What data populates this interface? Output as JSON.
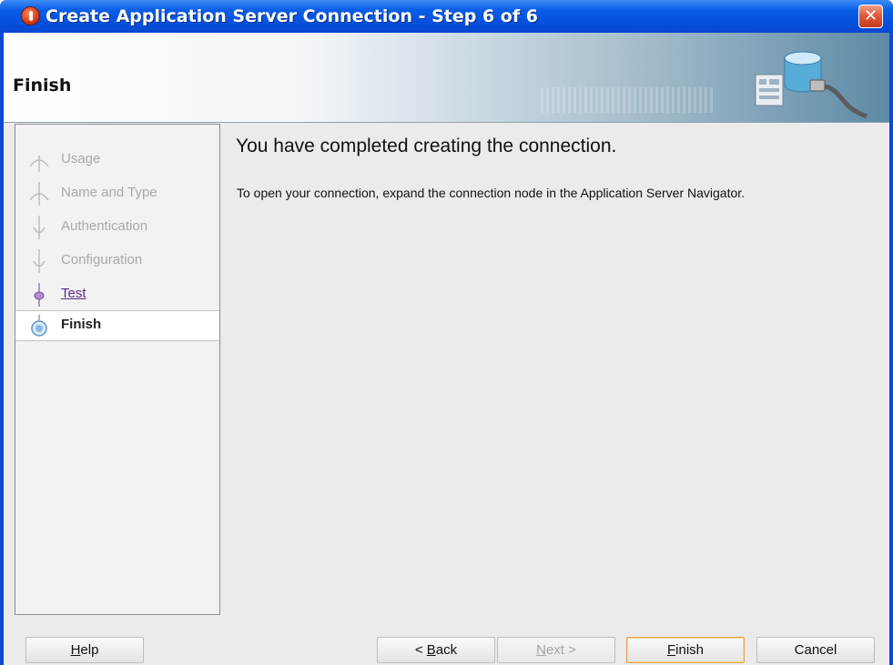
{
  "window": {
    "title": "Create Application Server Connection - Step 6 of 6",
    "close_glyph": "✕"
  },
  "banner": {
    "title": "Finish",
    "art_icon": "database-connection-icon"
  },
  "nav": {
    "items": [
      {
        "label": "Usage",
        "state": "disabled"
      },
      {
        "label": "Name and Type",
        "state": "disabled"
      },
      {
        "label": "Authentication",
        "state": "disabled"
      },
      {
        "label": "Configuration",
        "state": "disabled"
      },
      {
        "label": "Test",
        "state": "visited"
      },
      {
        "label": "Finish",
        "state": "current"
      }
    ]
  },
  "content": {
    "heading": "You have completed creating the connection.",
    "body": "To open your connection, expand the connection node in the Application Server Navigator."
  },
  "buttons": {
    "help": {
      "pre": "",
      "mnemonic": "H",
      "post": "elp"
    },
    "back": {
      "pre": "< ",
      "mnemonic": "B",
      "post": "ack"
    },
    "next": {
      "pre": "",
      "mnemonic": "N",
      "post": "ext >"
    },
    "finish": {
      "pre": "",
      "mnemonic": "F",
      "post": "inish"
    },
    "cancel": {
      "pre": "Cancel",
      "mnemonic": "",
      "post": ""
    }
  },
  "colors": {
    "titlebar": "#0550dd",
    "visited_link": "#5a2a86",
    "default_button_border": "#e3a348"
  }
}
